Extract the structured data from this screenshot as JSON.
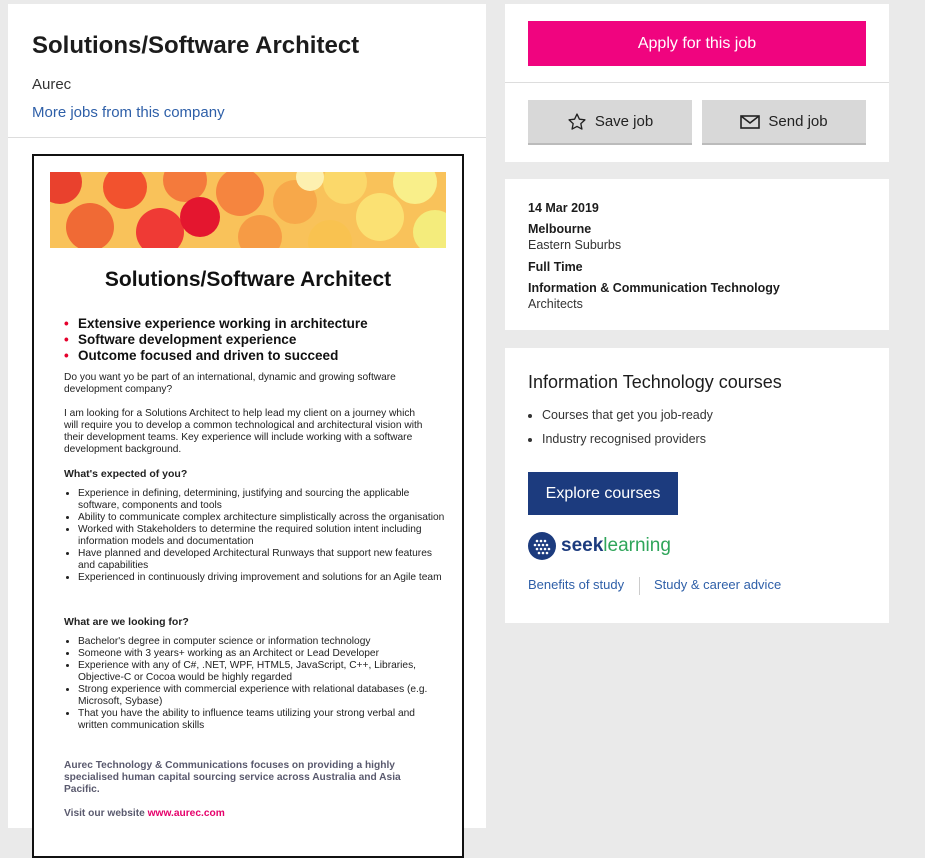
{
  "job": {
    "title": "Solutions/Software Architect",
    "company": "Aurec",
    "more_jobs": "More jobs from this company"
  },
  "ad": {
    "title": "Solutions/Software Architect",
    "highlights": [
      "Extensive experience working in architecture",
      "Software development experience",
      "Outcome focused and driven to succeed"
    ],
    "intro1": "Do you want yo be part of an international, dynamic and growing software development company?",
    "intro2": "I am looking for a Solutions Architect to help lead my client on a journey which will require you to develop a common technological and architectural vision with their development teams. Key experience will include working with a software development background.",
    "expected_heading": "What's expected of you?",
    "expected": [
      "Experience in defining, determining, justifying and sourcing the applicable software, components and tools",
      "Ability to communicate complex architecture simplistically across the organisation",
      "Worked with Stakeholders to determine the required solution intent including  information models and documentation",
      "Have planned and developed Architectural Runways that support new features and capabilities",
      "Experienced in continuously driving improvement and solutions for an Agile team"
    ],
    "looking_heading": "What are we looking for?",
    "looking": [
      "Bachelor's degree in computer science or information technology",
      "Someone with 3 years+ working as an Architect or Lead Developer",
      "Experience with any of C#, .NET, WPF, HTML5, JavaScript, C++, Libraries, Objective-C or Cocoa would be highly regarded",
      "Strong experience with commercial experience with relational databases (e.g. Microsoft, Sybase)",
      "That you have the ability to influence teams utilizing your strong verbal and written communication skills"
    ],
    "footer": "Aurec Technology & Communications focuses on providing a highly specialised human capital sourcing service across Australia and Asia Pacific.",
    "visit_label": "Visit our website ",
    "visit_link": "www.aurec.com"
  },
  "actions": {
    "apply": "Apply for this job",
    "save": "Save job",
    "send": "Send job"
  },
  "info": {
    "date": "14 Mar 2019",
    "location": "Melbourne",
    "area": "Eastern Suburbs",
    "work_type": "Full Time",
    "classification": "Information & Communication Technology",
    "sub_classification": "Architects"
  },
  "courses": {
    "heading": "Information Technology courses",
    "points": [
      "Courses that get you job-ready",
      "Industry recognised providers"
    ],
    "explore": "Explore courses",
    "logo_word1": "seek",
    "logo_word2": "learning",
    "link1": "Benefits of study",
    "link2": "Study & career advice"
  },
  "colors": {
    "apply": "#f0047f",
    "explore": "#1c3b7e",
    "link": "#2e5fa8"
  }
}
